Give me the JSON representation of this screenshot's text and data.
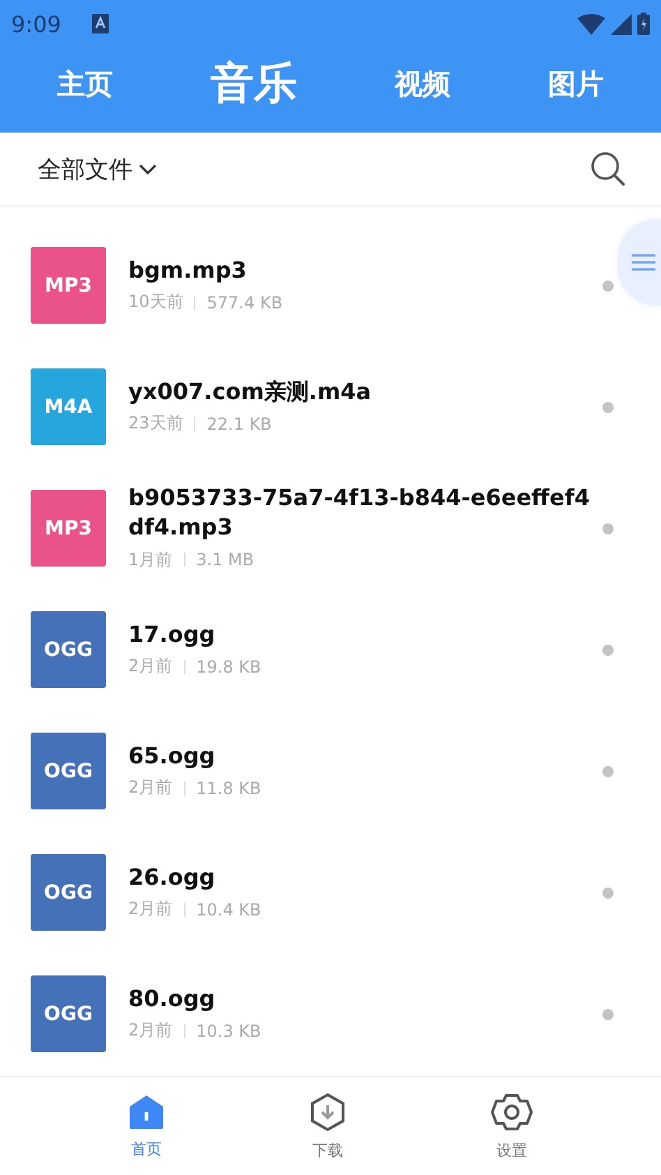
{
  "status_bar": {
    "time": "9:09"
  },
  "tabs": [
    {
      "label": "主页",
      "selected": false
    },
    {
      "label": "音乐",
      "selected": true
    },
    {
      "label": "视频",
      "selected": false
    },
    {
      "label": "图片",
      "selected": false
    }
  ],
  "filter": {
    "label": "全部文件"
  },
  "files": [
    {
      "type": "MP3",
      "color": "#e9538a",
      "name": "bgm.mp3",
      "age": "10天前",
      "size": "577.4 KB"
    },
    {
      "type": "M4A",
      "color": "#26a6dc",
      "name": "yx007.com亲测.m4a",
      "age": "23天前",
      "size": "22.1 KB"
    },
    {
      "type": "MP3",
      "color": "#e9538a",
      "name": "b9053733-75a7-4f13-b844-e6eeffef4df4.mp3",
      "age": "1月前",
      "size": "3.1 MB"
    },
    {
      "type": "OGG",
      "color": "#4471b8",
      "name": "17.ogg",
      "age": "2月前",
      "size": "19.8 KB"
    },
    {
      "type": "OGG",
      "color": "#4471b8",
      "name": "65.ogg",
      "age": "2月前",
      "size": "11.8 KB"
    },
    {
      "type": "OGG",
      "color": "#4471b8",
      "name": "26.ogg",
      "age": "2月前",
      "size": "10.4 KB"
    },
    {
      "type": "OGG",
      "color": "#4471b8",
      "name": "80.ogg",
      "age": "2月前",
      "size": "10.3 KB"
    }
  ],
  "bottom_nav": [
    {
      "kind": "home",
      "label": "首页",
      "selected": true
    },
    {
      "kind": "download",
      "label": "下载",
      "selected": false
    },
    {
      "kind": "settings",
      "label": "设置",
      "selected": false
    }
  ]
}
